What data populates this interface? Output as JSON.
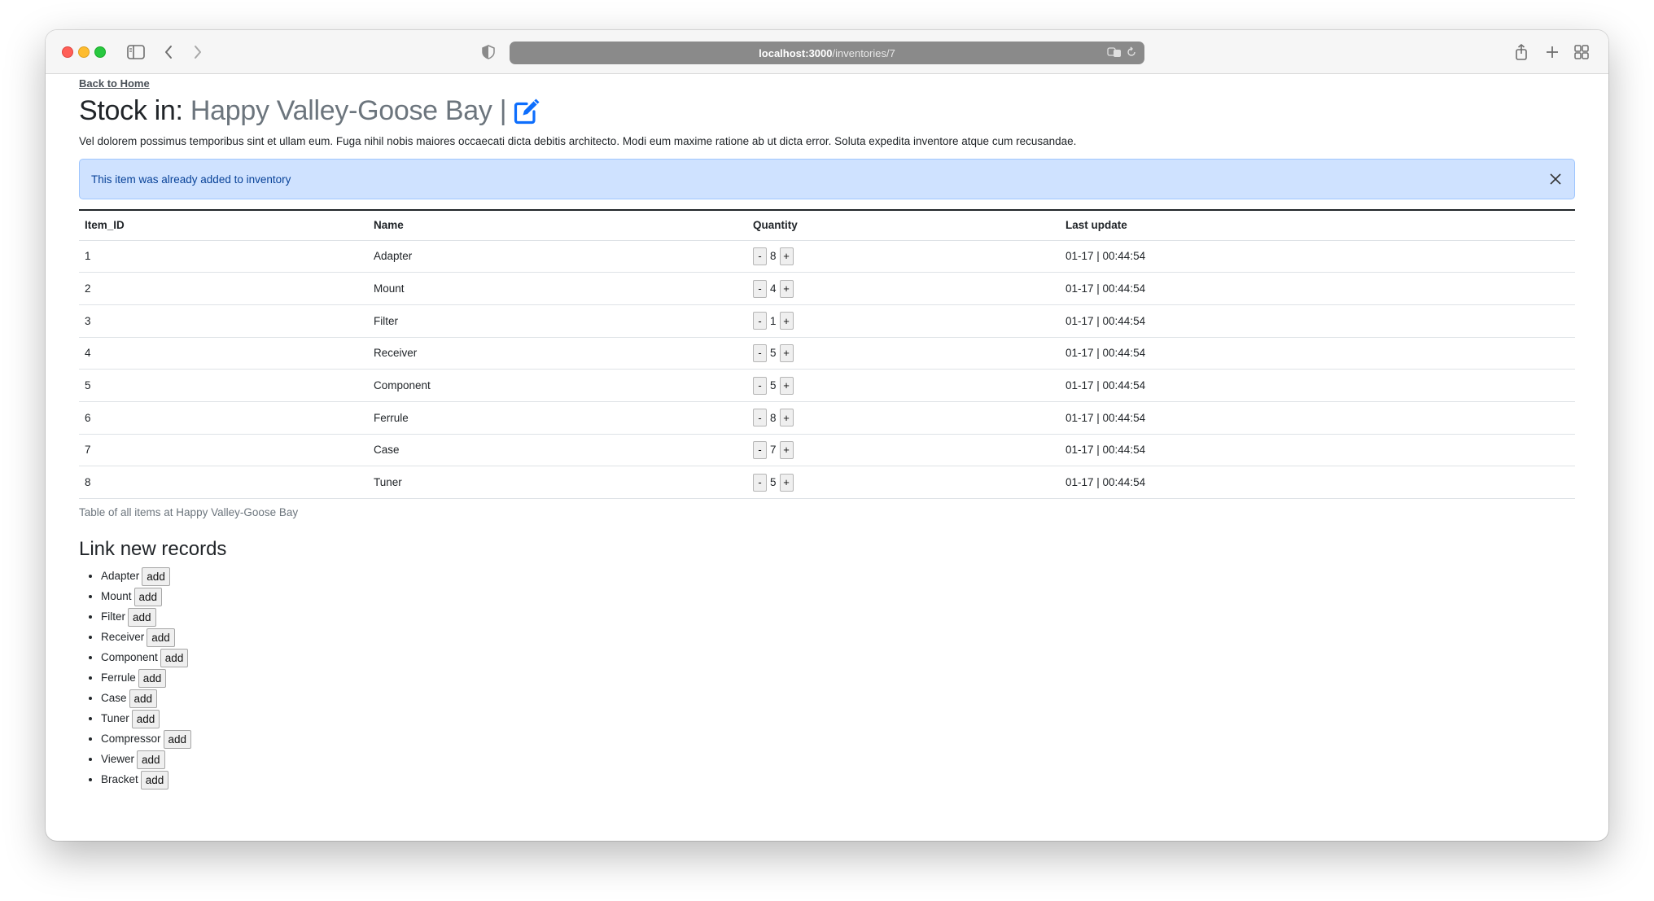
{
  "browser": {
    "url_host": "localhost:3000",
    "url_path": "/inventories/7"
  },
  "page": {
    "back_link": "Back to Home",
    "title_prefix": "Stock in:",
    "title_place": "Happy Valley-Goose Bay |",
    "description": "Vel dolorem possimus temporibus sint et ullam eum. Fuga nihil nobis maiores occaecati dicta debitis architecto. Modi eum maxime ratione ab ut dicta error. Soluta expedita inventore atque cum recusandae.",
    "alert": "This item was already added to inventory",
    "table": {
      "headers": [
        "Item_ID",
        "Name",
        "Quantity",
        "Last update"
      ],
      "minus_label": "-",
      "plus_label": "+",
      "rows": [
        {
          "id": "1",
          "name": "Adapter",
          "qty": "8",
          "updated": "01-17 | 00:44:54"
        },
        {
          "id": "2",
          "name": "Mount",
          "qty": "4",
          "updated": "01-17 | 00:44:54"
        },
        {
          "id": "3",
          "name": "Filter",
          "qty": "1",
          "updated": "01-17 | 00:44:54"
        },
        {
          "id": "4",
          "name": "Receiver",
          "qty": "5",
          "updated": "01-17 | 00:44:54"
        },
        {
          "id": "5",
          "name": "Component",
          "qty": "5",
          "updated": "01-17 | 00:44:54"
        },
        {
          "id": "6",
          "name": "Ferrule",
          "qty": "8",
          "updated": "01-17 | 00:44:54"
        },
        {
          "id": "7",
          "name": "Case",
          "qty": "7",
          "updated": "01-17 | 00:44:54"
        },
        {
          "id": "8",
          "name": "Tuner",
          "qty": "5",
          "updated": "01-17 | 00:44:54"
        }
      ],
      "caption": "Table of all items at Happy Valley-Goose Bay"
    },
    "link_section": {
      "heading": "Link new records",
      "add_label": "add",
      "items": [
        "Adapter",
        "Mount",
        "Filter",
        "Receiver",
        "Component",
        "Ferrule",
        "Case",
        "Tuner",
        "Compressor",
        "Viewer",
        "Bracket"
      ]
    }
  },
  "colors": {
    "alert_bg": "#cfe2ff",
    "alert_text": "#084298",
    "edit_icon": "#0d6efd"
  }
}
